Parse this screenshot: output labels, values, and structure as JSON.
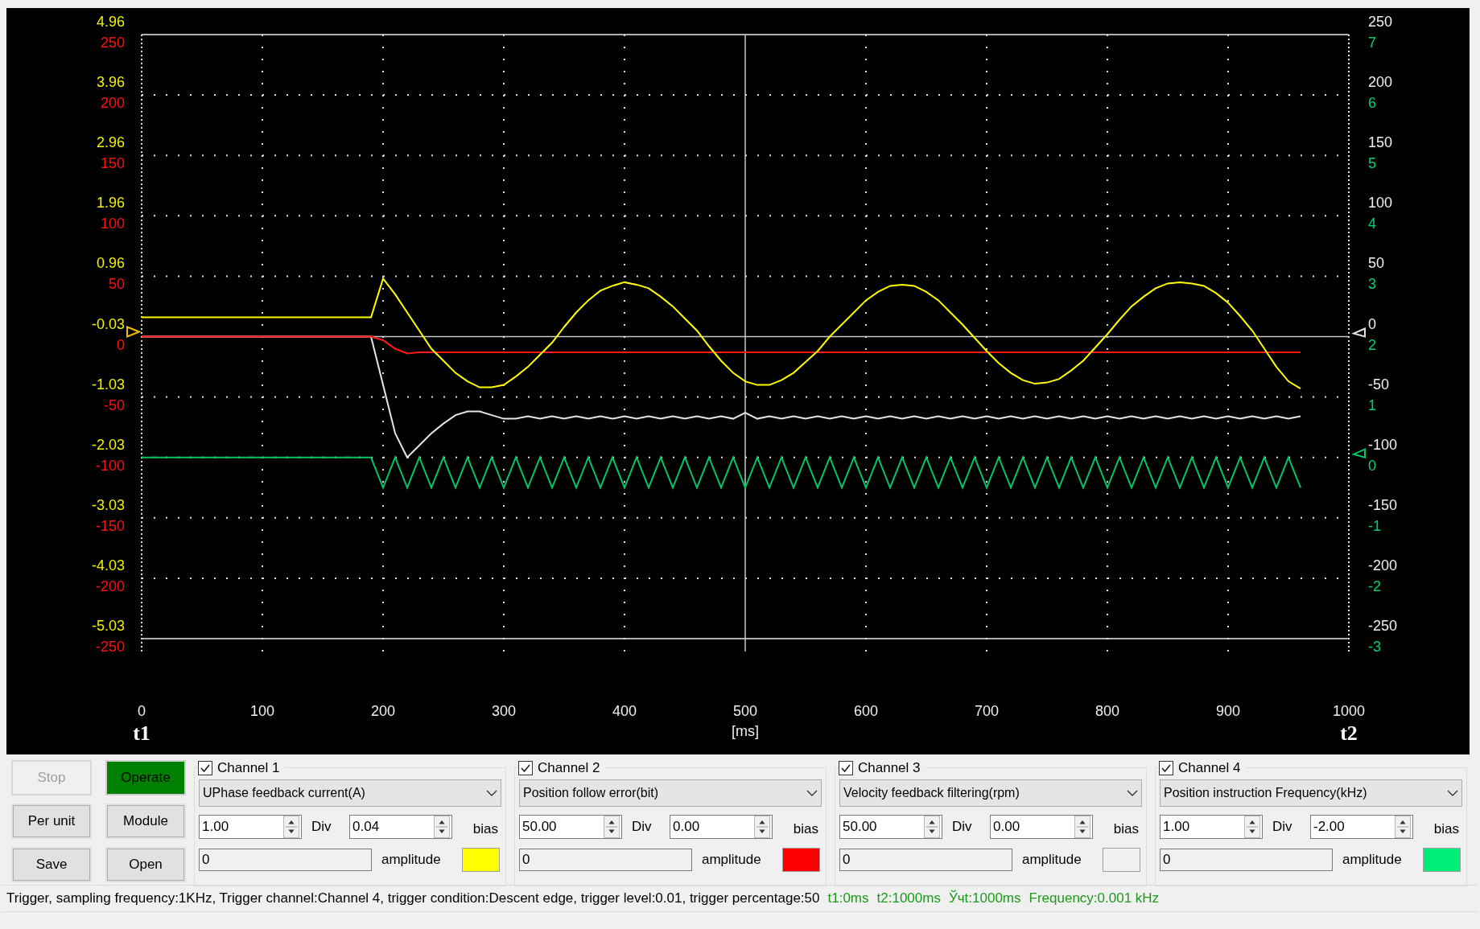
{
  "chart": {
    "chart_data": {
      "type": "line",
      "grid": true,
      "xlabel": "[ms]",
      "xlim": [
        0,
        1000
      ],
      "ylim": [
        -250,
        250
      ],
      "xticks": [
        0,
        100,
        200,
        300,
        400,
        500,
        600,
        700,
        800,
        900,
        1000
      ],
      "yticks": [
        250,
        200,
        150,
        100,
        50,
        0,
        -50,
        -100,
        -150,
        -200,
        -250
      ],
      "x": [
        0,
        10,
        20,
        30,
        40,
        50,
        60,
        70,
        80,
        90,
        100,
        110,
        120,
        130,
        140,
        150,
        160,
        170,
        180,
        190,
        200,
        210,
        220,
        230,
        240,
        250,
        260,
        270,
        280,
        290,
        300,
        310,
        320,
        330,
        340,
        350,
        360,
        370,
        380,
        390,
        400,
        410,
        420,
        430,
        440,
        450,
        460,
        470,
        480,
        490,
        500,
        510,
        520,
        530,
        540,
        550,
        560,
        570,
        580,
        590,
        600,
        610,
        620,
        630,
        640,
        650,
        660,
        670,
        680,
        690,
        700,
        710,
        720,
        730,
        740,
        750,
        760,
        770,
        780,
        790,
        800,
        810,
        820,
        830,
        840,
        850,
        860,
        870,
        880,
        890,
        900,
        910,
        920,
        930,
        940,
        950,
        960
      ],
      "series": [
        {
          "name": "Channel 1",
          "color": "#ffff00",
          "values": [
            16,
            16,
            16,
            16,
            16,
            16,
            16,
            16,
            16,
            16,
            16,
            16,
            16,
            16,
            16,
            16,
            16,
            16,
            16,
            16,
            48,
            35,
            20,
            5,
            -10,
            -20,
            -30,
            -37,
            -42,
            -42,
            -40,
            -33,
            -25,
            -15,
            -5,
            8,
            20,
            30,
            38,
            42,
            45,
            43,
            40,
            33,
            25,
            15,
            5,
            -8,
            -20,
            -30,
            -37,
            -40,
            -40,
            -36,
            -30,
            -21,
            -12,
            0,
            10,
            20,
            30,
            37,
            42,
            43,
            42,
            37,
            30,
            20,
            10,
            -1,
            -12,
            -22,
            -30,
            -36,
            -39,
            -38,
            -35,
            -28,
            -20,
            -9,
            2,
            14,
            25,
            33,
            40,
            44,
            45,
            44,
            42,
            36,
            28,
            17,
            5,
            -10,
            -25,
            -37,
            -43
          ]
        },
        {
          "name": "Channel 2",
          "color": "#ff1a1a",
          "values": [
            0,
            0,
            0,
            0,
            0,
            0,
            0,
            0,
            0,
            0,
            0,
            0,
            0,
            0,
            0,
            0,
            0,
            0,
            0,
            0,
            -3,
            -10,
            -14,
            -13,
            -13,
            -13,
            -13,
            -13,
            -13,
            -13,
            -13,
            -13,
            -13,
            -13,
            -13,
            -13,
            -13,
            -13,
            -13,
            -13,
            -13,
            -13,
            -13,
            -13,
            -13,
            -13,
            -13,
            -13,
            -13,
            -13,
            -13,
            -13,
            -13,
            -13,
            -13,
            -13,
            -13,
            -13,
            -13,
            -13,
            -13,
            -13,
            -13,
            -13,
            -13,
            -13,
            -13,
            -13,
            -13,
            -13,
            -13,
            -13,
            -13,
            -13,
            -13,
            -13,
            -13,
            -13,
            -13,
            -13,
            -13,
            -13,
            -13,
            -13,
            -13,
            -13,
            -13,
            -13,
            -13,
            -13,
            -13,
            -13,
            -13,
            -13,
            -13,
            -13,
            -13
          ]
        },
        {
          "name": "Channel 3",
          "color": "#e6e6e6",
          "values": [
            0,
            0,
            0,
            0,
            0,
            0,
            0,
            0,
            0,
            0,
            0,
            0,
            0,
            0,
            0,
            0,
            0,
            0,
            0,
            0,
            -40,
            -80,
            -100,
            -90,
            -80,
            -72,
            -65,
            -62,
            -62,
            -65,
            -68,
            -68,
            -66,
            -68,
            -66,
            -68,
            -66,
            -68,
            -66,
            -68,
            -66,
            -68,
            -66,
            -68,
            -66,
            -68,
            -66,
            -68,
            -66,
            -68,
            -63,
            -68,
            -66,
            -68,
            -66,
            -68,
            -66,
            -68,
            -66,
            -68,
            -66,
            -68,
            -66,
            -68,
            -66,
            -68,
            -66,
            -68,
            -66,
            -68,
            -66,
            -68,
            -66,
            -68,
            -66,
            -68,
            -66,
            -68,
            -66,
            -68,
            -66,
            -68,
            -66,
            -68,
            -66,
            -68,
            -66,
            -68,
            -66,
            -68,
            -66,
            -68,
            -66,
            -68,
            -66,
            -68,
            -66
          ]
        },
        {
          "name": "Channel 4",
          "color": "#00c864",
          "values": [
            -100,
            -100,
            -100,
            -100,
            -100,
            -100,
            -100,
            -100,
            -100,
            -100,
            -100,
            -100,
            -100,
            -100,
            -100,
            -100,
            -100,
            -100,
            -100,
            -100,
            -125,
            -100,
            -125,
            -100,
            -125,
            -100,
            -125,
            -100,
            -125,
            -100,
            -125,
            -100,
            -125,
            -100,
            -125,
            -100,
            -125,
            -100,
            -125,
            -100,
            -125,
            -100,
            -125,
            -100,
            -125,
            -100,
            -125,
            -100,
            -125,
            -100,
            -125,
            -100,
            -125,
            -100,
            -125,
            -100,
            -125,
            -100,
            -125,
            -100,
            -125,
            -100,
            -125,
            -100,
            -125,
            -100,
            -125,
            -100,
            -125,
            -100,
            -125,
            -100,
            -125,
            -100,
            -125,
            -100,
            -125,
            -100,
            -125,
            -100,
            -125,
            -100,
            -125,
            -100,
            -125,
            -100,
            -125,
            -100,
            -125,
            -100,
            -125,
            -100,
            -125,
            -100,
            -125,
            -100,
            -125
          ]
        }
      ]
    },
    "x_tick_labels": [
      "0",
      "100",
      "200",
      "300",
      "400",
      "500",
      "600",
      "700",
      "800",
      "900",
      "1000"
    ],
    "left_outer_labels": [
      "4.96",
      "3.96",
      "2.96",
      "1.96",
      "0.96",
      "-0.03",
      "-1.03",
      "-2.03",
      "-3.03",
      "-4.03",
      "-5.03"
    ],
    "left_inner_labels": [
      "250",
      "200",
      "150",
      "100",
      "50",
      "0",
      "-50",
      "-100",
      "-150",
      "-200",
      "-250"
    ],
    "right_upper_labels": [
      "250",
      "200",
      "150",
      "100",
      "50",
      "0",
      "-50",
      "-100",
      "-150",
      "-200",
      "-250"
    ],
    "right_lower_labels": [
      "7",
      "6",
      "5",
      "4",
      "3",
      "2",
      "1",
      "0",
      "-1",
      "-2",
      "-3"
    ],
    "cursor_left": "t1",
    "cursor_right": "t2"
  },
  "buttons": [
    {
      "label": "Stop",
      "disabled": true,
      "highlighted": false
    },
    {
      "label": "Operate",
      "disabled": false,
      "highlighted": true
    },
    {
      "label": "Per unit",
      "disabled": false,
      "highlighted": false
    },
    {
      "label": "Module",
      "disabled": false,
      "highlighted": false
    },
    {
      "label": "Save",
      "disabled": false,
      "highlighted": false
    },
    {
      "label": "Open",
      "disabled": false,
      "highlighted": false
    }
  ],
  "channels": [
    {
      "checked": true,
      "signal": "UPhase feedback current(A)",
      "div": "1.00",
      "div_label": "Div",
      "bias": "0.04",
      "bias_label": "bias",
      "amplitude": "0",
      "amplitude_label": "amplitude",
      "color": "#ffff00"
    },
    {
      "checked": true,
      "signal": "Position follow error(bit)",
      "div": "50.00",
      "div_label": "Div",
      "bias": "0.00",
      "bias_label": "bias",
      "amplitude": "0",
      "amplitude_label": "amplitude",
      "color": "#ff0000"
    },
    {
      "checked": true,
      "signal": "Velocity feedback filtering(rpm)",
      "div": "50.00",
      "div_label": "Div",
      "bias": "0.00",
      "bias_label": "bias",
      "amplitude": "0",
      "amplitude_label": "amplitude",
      "color": "#f0f0f0"
    },
    {
      "checked": true,
      "signal": "Position instruction Frequency(kHz)",
      "div": "1.00",
      "div_label": "Div",
      "bias": "-2.00",
      "bias_label": "bias",
      "amplitude": "0",
      "amplitude_label": "amplitude",
      "color": "#00ee77"
    }
  ],
  "status_bar": {
    "trigger_info": "Trigger, sampling frequency:1KHz, Trigger channel:Channel 4, trigger condition:Descent edge, trigger level:0.01, trigger percentage:50",
    "t1": "t1:0ms",
    "t2": "t2:1000ms",
    "delta": "Ўчt:1000ms",
    "frequency": "Frequency:0.001 kHz"
  }
}
